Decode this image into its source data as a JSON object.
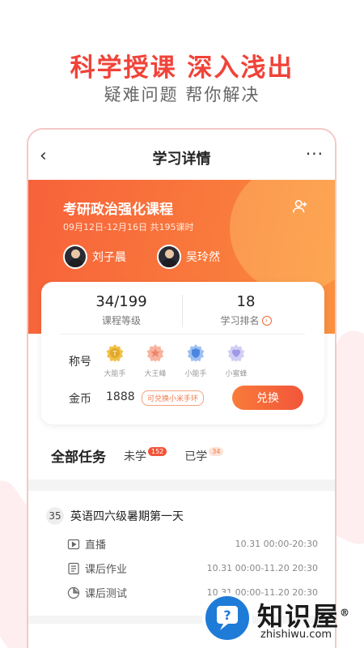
{
  "hero": {
    "title": "科学授课 深入浅出",
    "subtitle": "疑难问题 帮你解决"
  },
  "nav": {
    "back": "‹",
    "title": "学习详情",
    "more": "···"
  },
  "course": {
    "title": "考研政治强化课程",
    "dates": "09月12日-12月16日 共195课时",
    "teachers": [
      "刘子晨",
      "吴玲然"
    ]
  },
  "stats": {
    "level_value": "34/199",
    "level_label": "课程等级",
    "rank_value": "18",
    "rank_label": "学习排名"
  },
  "titles": {
    "label": "称号",
    "badges": [
      {
        "name": "大能手",
        "color": "#e0a928"
      },
      {
        "name": "大王峰",
        "color": "#f0826a"
      },
      {
        "name": "小能手",
        "color": "#4c86e0"
      },
      {
        "name": "小蜜蜂",
        "color": "#9e9ae6"
      }
    ]
  },
  "coins": {
    "label": "金币",
    "value": "1888",
    "tag": "可兑换小米手环",
    "button": "兑换"
  },
  "tabs": {
    "all": "全部任务",
    "unlearned": "未学",
    "unlearned_count": "152",
    "learned": "已学",
    "learned_count": "34"
  },
  "task_day": {
    "num": "35",
    "title": "英语四六级暑期第一天",
    "items": [
      {
        "icon": "play-icon",
        "name": "直播",
        "time": "10.31 00:00-20:30"
      },
      {
        "icon": "homework-icon",
        "name": "课后作业",
        "time": "10.31 00:00-11.20 20:30"
      },
      {
        "icon": "test-icon",
        "name": "课后测试",
        "time": "10.31 00:00-11.20 20:30"
      }
    ]
  },
  "watermark": {
    "text": "知识屋",
    "reg": "®",
    "sub": "zhishiwu.com"
  }
}
